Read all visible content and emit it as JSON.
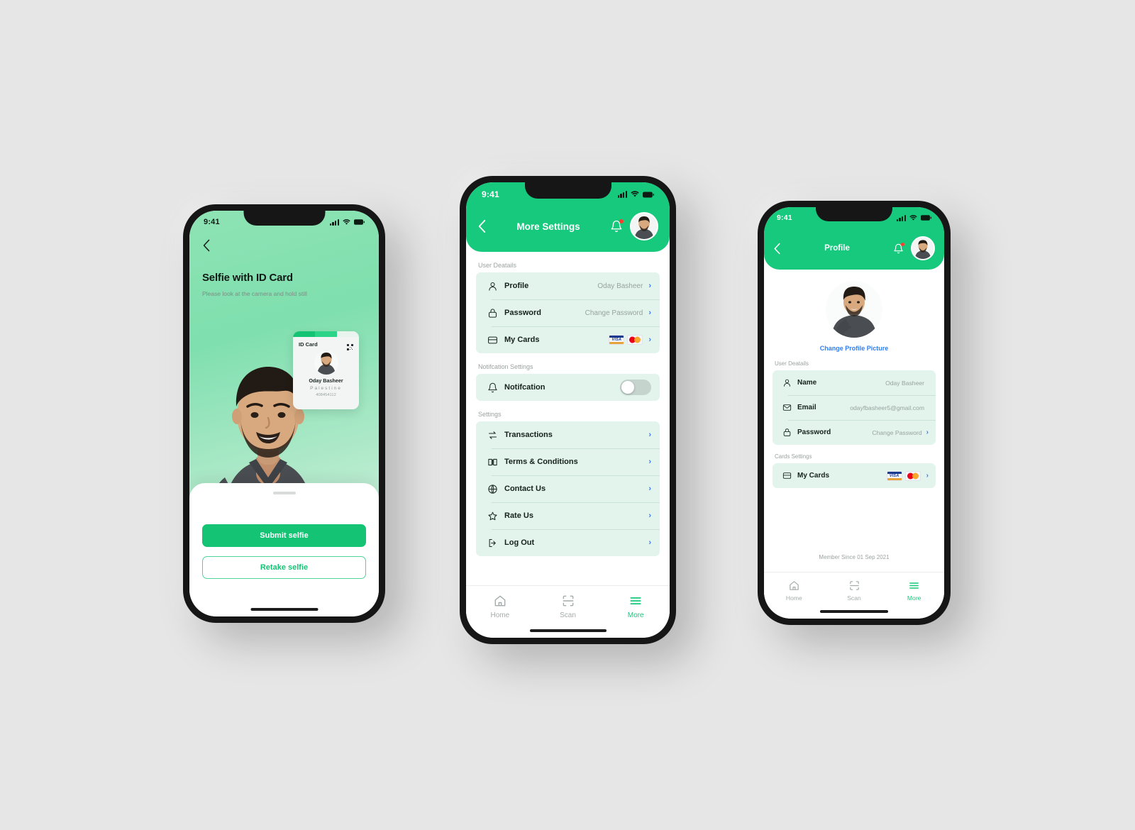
{
  "accent": "#17c97c",
  "status_bar": {
    "time": "9:41",
    "icons": [
      "signal-icon",
      "wifi-icon",
      "battery-icon"
    ]
  },
  "screen1": {
    "name": "selfie-with-id-card-screen",
    "back_icon": "chevron-left-icon",
    "title": "Selfie with ID Card",
    "subtitle": "Please look at the camera and hold still",
    "id_card": {
      "label": "ID Card",
      "qr_icon": "qr-code-icon",
      "name": "Oday Basheer",
      "country": "Palestine",
      "number": "408454112"
    },
    "primary_button": "Submit selfie",
    "secondary_button": "Retake selfie"
  },
  "screen2": {
    "name": "more-settings-screen",
    "back_icon": "chevron-left-icon",
    "title": "More Settings",
    "bell_icon": "bell-icon",
    "avatar": "user-avatar",
    "sections": [
      {
        "label": "User Deatails",
        "rows": [
          {
            "icon": "person-icon",
            "label": "Profile",
            "value": "Oday Basheer",
            "chevron": "chevron-right-icon"
          },
          {
            "icon": "lock-icon",
            "label": "Password",
            "value": "Change Password",
            "chevron": "chevron-right-icon"
          },
          {
            "icon": "credit-card-icon",
            "label": "My Cards",
            "value": "",
            "cards": [
              "visa-logo",
              "mastercard-logo"
            ],
            "chevron": "chevron-right-icon"
          }
        ]
      },
      {
        "label": "Notifcation Settings",
        "rows": [
          {
            "icon": "bell-icon",
            "label": "Notifcation",
            "toggle": "off"
          }
        ]
      },
      {
        "label": "Settings",
        "rows": [
          {
            "icon": "transfer-icon",
            "label": "Transactions",
            "chevron": "chevron-right-icon"
          },
          {
            "icon": "book-icon",
            "label": "Terms & Conditions",
            "chevron": "chevron-right-icon"
          },
          {
            "icon": "globe-icon",
            "label": "Contact Us",
            "chevron": "chevron-right-icon"
          },
          {
            "icon": "star-icon",
            "label": "Rate Us",
            "chevron": "chevron-right-icon"
          },
          {
            "icon": "logout-icon",
            "label": "Log Out",
            "chevron": "chevron-right-icon"
          }
        ]
      }
    ],
    "tabs": [
      {
        "icon": "home-icon",
        "label": "Home",
        "active": false
      },
      {
        "icon": "scan-icon",
        "label": "Scan",
        "active": false
      },
      {
        "icon": "menu-icon",
        "label": "More",
        "active": true
      }
    ]
  },
  "screen3": {
    "name": "profile-screen",
    "back_icon": "chevron-left-icon",
    "title": "Profile",
    "bell_icon": "bell-icon",
    "avatar": "user-avatar",
    "change_picture": "Change Profile Picture",
    "sections": [
      {
        "label": "User Deatails",
        "rows": [
          {
            "icon": "person-icon",
            "label": "Name",
            "value": "Oday Basheer"
          },
          {
            "icon": "mail-icon",
            "label": "Email",
            "value": "odayfbasheer5@gmail.com"
          },
          {
            "icon": "lock-icon",
            "label": "Password",
            "value": "Change Password",
            "chevron": "chevron-right-icon"
          }
        ]
      },
      {
        "label": "Cards Settings",
        "rows": [
          {
            "icon": "credit-card-icon",
            "label": "My Cards",
            "cards": [
              "visa-logo",
              "mastercard-logo"
            ],
            "chevron": "chevron-right-icon"
          }
        ]
      }
    ],
    "member_since": "Member Since 01 Sep 2021",
    "tabs": [
      {
        "icon": "home-icon",
        "label": "Home",
        "active": false
      },
      {
        "icon": "scan-icon",
        "label": "Scan",
        "active": false
      },
      {
        "icon": "menu-icon",
        "label": "More",
        "active": true
      }
    ]
  }
}
